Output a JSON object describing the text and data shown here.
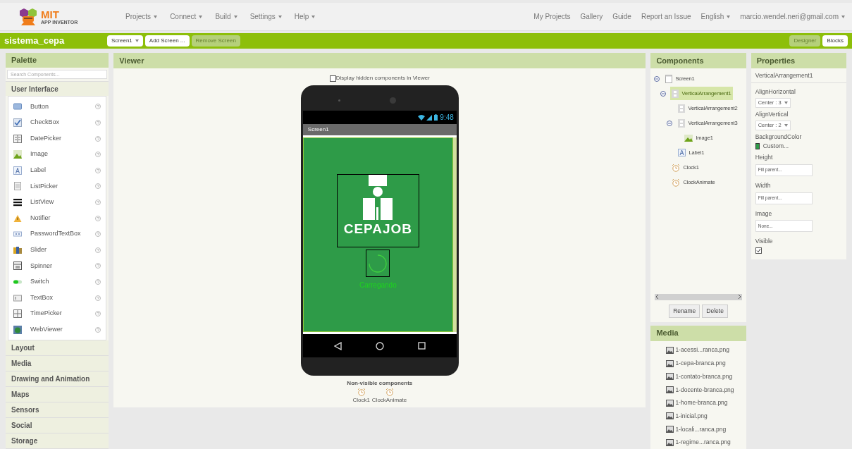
{
  "top_menu": [
    {
      "label": "Projects",
      "dropdown": true
    },
    {
      "label": "Connect",
      "dropdown": true
    },
    {
      "label": "Build",
      "dropdown": true
    },
    {
      "label": "Settings",
      "dropdown": true
    },
    {
      "label": "Help",
      "dropdown": true
    }
  ],
  "logo": {
    "title": "MIT",
    "subtitle": "APP INVENTOR"
  },
  "right_menu": [
    {
      "label": "My Projects",
      "dropdown": false
    },
    {
      "label": "Gallery",
      "dropdown": false
    },
    {
      "label": "Guide",
      "dropdown": false
    },
    {
      "label": "Report an Issue",
      "dropdown": false
    },
    {
      "label": "English",
      "dropdown": true
    },
    {
      "label": "marcio.wendel.neri@gmail.com",
      "dropdown": true
    }
  ],
  "project": {
    "name": "sistema_cepa",
    "screen_select": "Screen1",
    "buttons": [
      {
        "label": "Add Screen ...",
        "disabled": false
      },
      {
        "label": "Remove Screen",
        "disabled": true
      }
    ],
    "modes": [
      {
        "label": "Designer",
        "selected": true
      },
      {
        "label": "Blocks",
        "selected": false
      }
    ]
  },
  "palette": {
    "title": "Palette",
    "search": {
      "placeholder": "Search Components..."
    },
    "open_category": "User Interface",
    "items": [
      {
        "label": "Button",
        "help": "?"
      },
      {
        "label": "CheckBox",
        "help": "?"
      },
      {
        "label": "DatePicker",
        "help": "?"
      },
      {
        "label": "Image",
        "help": "?"
      },
      {
        "label": "Label",
        "help": "?"
      },
      {
        "label": "ListPicker",
        "help": "?"
      },
      {
        "label": "ListView",
        "help": "?"
      },
      {
        "label": "Notifier",
        "help": "?"
      },
      {
        "label": "PasswordTextBox",
        "help": "?"
      },
      {
        "label": "Slider",
        "help": "?"
      },
      {
        "label": "Spinner",
        "help": "?"
      },
      {
        "label": "Switch",
        "help": "?"
      },
      {
        "label": "TextBox",
        "help": "?"
      },
      {
        "label": "TimePicker",
        "help": "?"
      },
      {
        "label": "WebViewer",
        "help": "?"
      }
    ],
    "categories": [
      "Layout",
      "Media",
      "Drawing and Animation",
      "Maps",
      "Sensors",
      "Social",
      "Storage"
    ]
  },
  "viewer": {
    "title": "Viewer",
    "hidden_toggle": {
      "label": "Display hidden components in Viewer",
      "checked": false
    },
    "phone": {
      "time": "9:48",
      "screen_title": "Screen1",
      "logo_text": "CEPAJOB",
      "label": "Carregando"
    },
    "nonvisible": {
      "title": "Non-visible components",
      "items": [
        "Clock1",
        "ClockAnimate"
      ]
    }
  },
  "components": {
    "title": "Components",
    "tree": [
      {
        "label": "Screen1",
        "kind": "screen",
        "expanded": true,
        "selected": false,
        "children": [
          {
            "label": "VerticalArrangement1",
            "kind": "arrangement",
            "expanded": true,
            "selected": true,
            "children": [
              {
                "label": "VerticalArrangement2",
                "kind": "arrangement",
                "selected": false
              },
              {
                "label": "VerticalArrangement3",
                "kind": "arrangement",
                "expanded": true,
                "selected": false,
                "children": [
                  {
                    "label": "Image1",
                    "kind": "image",
                    "selected": false
                  }
                ]
              },
              {
                "label": "Label1",
                "kind": "label",
                "selected": false
              }
            ]
          },
          {
            "label": "Clock1",
            "kind": "clock",
            "selected": false
          },
          {
            "label": "ClockAnimate",
            "kind": "clock",
            "selected": false
          }
        ]
      }
    ],
    "buttons": [
      "Rename",
      "Delete"
    ]
  },
  "media": {
    "title": "Media",
    "files": [
      "1-acessi...ranca.png",
      "1-cepa-branca.png",
      "1-contato-branca.png",
      "1-docente-branca.png",
      "1-home-branca.png",
      "1-inicial.png",
      "1-locali...ranca.png",
      "1-regime...ranca.png"
    ]
  },
  "properties": {
    "title": "Properties",
    "component": "VerticalArrangement1",
    "props": [
      {
        "name": "AlignHorizontal",
        "kind": "select",
        "value": "Center : 3"
      },
      {
        "name": "AlignVertical",
        "kind": "select",
        "value": "Center : 2"
      },
      {
        "name": "BackgroundColor",
        "kind": "color",
        "value": "Custom...",
        "color": "#2e9b48"
      },
      {
        "name": "Height",
        "kind": "text",
        "value": "Fill parent..."
      },
      {
        "name": "Width",
        "kind": "text",
        "value": "Fill parent..."
      },
      {
        "name": "Image",
        "kind": "text",
        "value": "None..."
      },
      {
        "name": "Visible",
        "kind": "checkbox",
        "checked": true
      }
    ]
  }
}
